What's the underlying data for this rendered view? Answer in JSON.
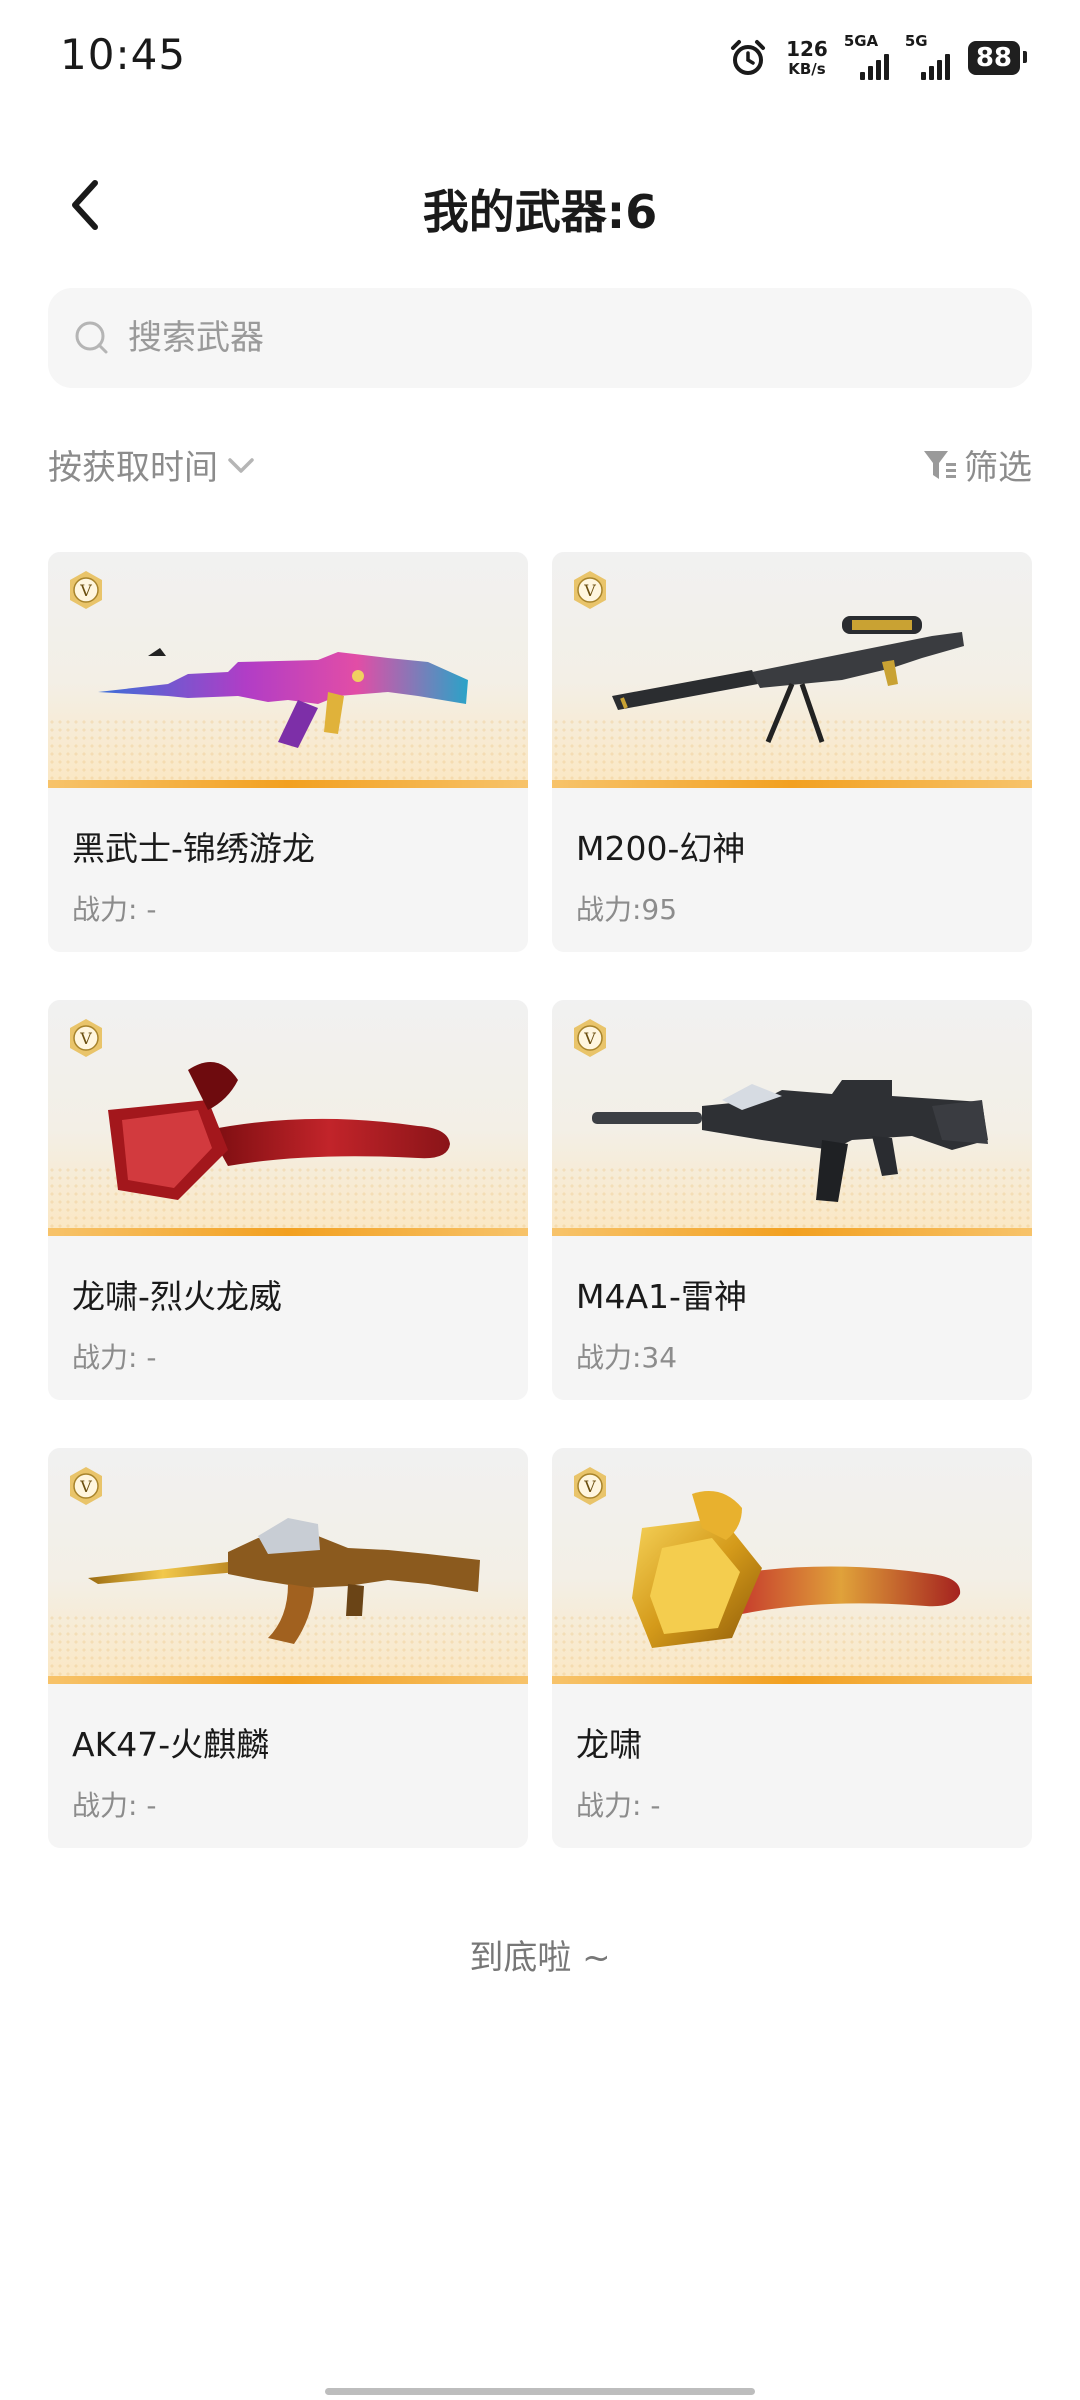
{
  "status_bar": {
    "time": "10:45",
    "net_speed": "126",
    "net_unit": "KB/s",
    "signal1_label": "5GA",
    "signal2_label": "5G",
    "battery": "88"
  },
  "header": {
    "title": "我的武器:6"
  },
  "search": {
    "placeholder": "搜索武器"
  },
  "toolbar": {
    "sort_label": "按获取时间",
    "filter_label": "筛选"
  },
  "weapons": [
    {
      "name": "黑武士-锦绣游龙",
      "power": "战力: -",
      "art": "rifle-purple"
    },
    {
      "name": "M200-幻神",
      "power": "战力:95",
      "art": "sniper"
    },
    {
      "name": "龙啸-烈火龙威",
      "power": "战力: -",
      "art": "axe-red"
    },
    {
      "name": "M4A1-雷神",
      "power": "战力:34",
      "art": "m4a1"
    },
    {
      "name": "AK47-火麒麟",
      "power": "战力: -",
      "art": "ak-gold"
    },
    {
      "name": "龙啸",
      "power": "战力: -",
      "art": "axe-gold"
    }
  ],
  "footer": {
    "end_text": "到底啦 ~"
  },
  "colors": {
    "accent_orange": "#f2a020",
    "text_primary": "#1a1a1a",
    "text_secondary": "#8c8c8c",
    "card_bg": "#f5f5f5",
    "search_bg": "#f6f6f6"
  }
}
